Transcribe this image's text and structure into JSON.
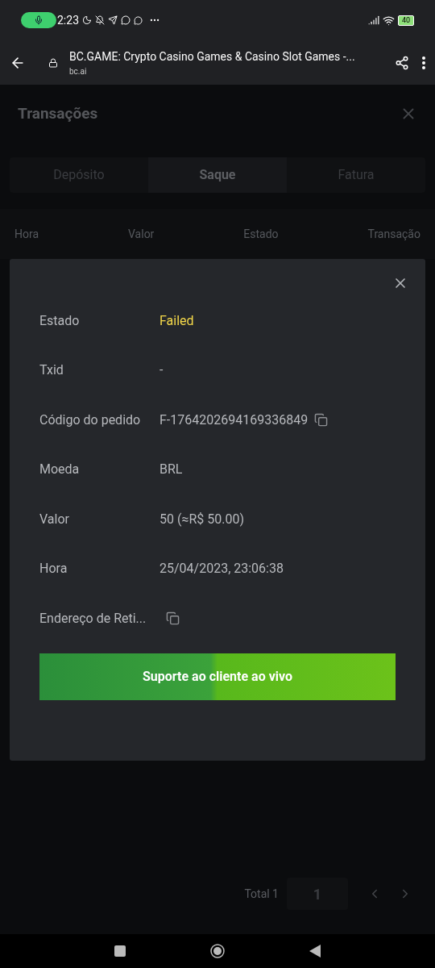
{
  "status_bar": {
    "time": "2:23",
    "battery": "40"
  },
  "browser": {
    "title": "BC.GAME: Crypto Casino Games & Casino Slot Games -...",
    "url": "bc.ai"
  },
  "page": {
    "title": "Transações",
    "tabs": [
      {
        "label": "Depósito",
        "selected": false
      },
      {
        "label": "Saque",
        "selected": true
      },
      {
        "label": "Fatura",
        "selected": false
      }
    ],
    "columns": [
      "Hora",
      "Valor",
      "Estado",
      "Transação"
    ],
    "pagination": {
      "total": "Total 1",
      "page": "1"
    }
  },
  "modal": {
    "rows": [
      {
        "label": "Estado",
        "value": "Failed",
        "kind": "status",
        "copyable": false
      },
      {
        "label": "Txid",
        "value": "-",
        "kind": "text",
        "copyable": false
      },
      {
        "label": "Código do pedido",
        "value": "F-1764202694169336849",
        "kind": "text",
        "copyable": true
      },
      {
        "label": "Moeda",
        "value": "BRL",
        "kind": "text",
        "copyable": false
      },
      {
        "label": "Valor",
        "value": "50 (≈R$ 50.00)",
        "kind": "text",
        "copyable": false
      },
      {
        "label": "Hora",
        "value": "25/04/2023, 23:06:38",
        "kind": "text",
        "copyable": false
      },
      {
        "label": "Endereço de Reti...",
        "copyable": true
      }
    ],
    "button": "Suporte ao cliente ao vivo"
  }
}
